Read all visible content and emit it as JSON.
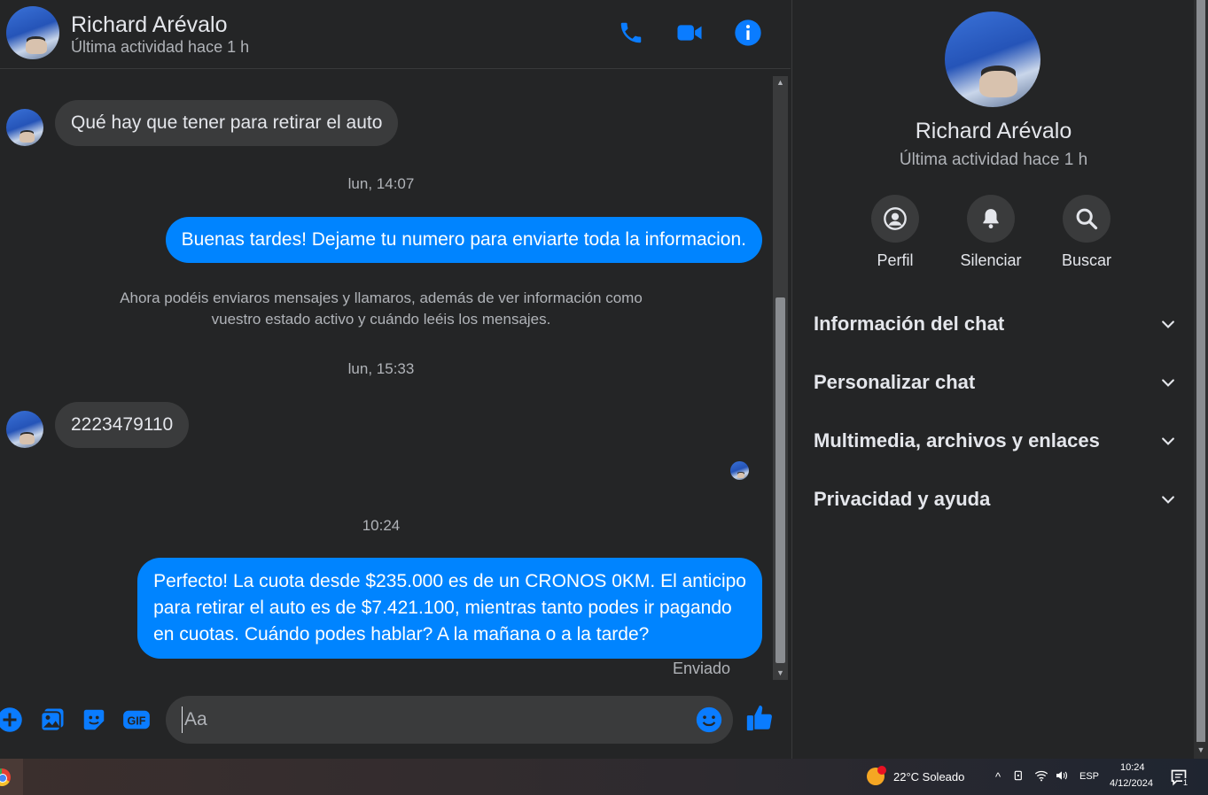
{
  "header": {
    "name": "Richard Arévalo",
    "status": "Última actividad hace 1 h",
    "icons": [
      "phone-icon",
      "video-camera-icon",
      "info-icon"
    ]
  },
  "messages": {
    "incoming_1": "Qué hay que tener para retirar el auto",
    "timestamp_1": "lun, 14:07",
    "outgoing_1": "Buenas tardes! Dejame tu numero para enviarte toda la informacion.",
    "system_line_1": "Ahora podéis enviaros mensajes y llamaros, además de ver información como",
    "system_line_2": "vuestro estado activo y cuándo leéis los mensajes.",
    "timestamp_2": "lun, 15:33",
    "incoming_2": "2223479110",
    "timestamp_3": "10:24",
    "outgoing_2_line_1": "Perfecto! La cuota desde $235.000 es de un CRONOS 0KM. El anticipo",
    "outgoing_2_line_2": "para retirar el auto es de $7.421.100, mientras tanto podes ir pagando",
    "outgoing_2_line_3": "en cuotas. Cuándo podes hablar? A la mañana o a la tarde?",
    "sent_label": "Enviado"
  },
  "composer": {
    "placeholder": "Aa",
    "icons": [
      "plus-icon",
      "photo-icon",
      "sticker-icon",
      "gif-icon",
      "emoji-icon",
      "like-icon"
    ]
  },
  "info_panel": {
    "name": "Richard Arévalo",
    "status": "Última actividad hace 1 h",
    "actions": [
      {
        "label": "Perfil",
        "icon": "profile-icon"
      },
      {
        "label": "Silenciar",
        "icon": "bell-icon"
      },
      {
        "label": "Buscar",
        "icon": "search-icon"
      }
    ],
    "sections": [
      "Información del chat",
      "Personalizar chat",
      "Multimedia, archivos y enlaces",
      "Privacidad y ayuda"
    ]
  },
  "taskbar": {
    "weather": "22°C  Soleado",
    "language": "ESP",
    "time": "10:24",
    "date": "4/12/2024",
    "notification_count": "1"
  },
  "colors": {
    "accent": "#0084ff",
    "background": "#242526",
    "bubble_in": "#3a3b3c"
  }
}
